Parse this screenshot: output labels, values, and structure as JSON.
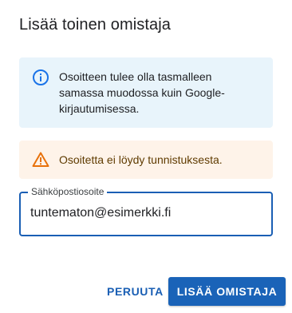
{
  "dialog": {
    "title": "Lisää toinen omistaja"
  },
  "info_notice": {
    "icon": "info-icon",
    "text": "Osoitteen tulee olla tasmalleen samassa muodossa kuin Google-kirjautumisessa.",
    "background": "#e8f4fb",
    "icon_color": "#1a73e8"
  },
  "warning_notice": {
    "icon": "warning-icon",
    "text": "Osoitetta ei löydy tunnistuksesta.",
    "background": "#fef3e9",
    "icon_color": "#e8710a"
  },
  "email_field": {
    "label": "Sähköpostiosoite",
    "value": "tuntematon@esimerkki.fi"
  },
  "actions": {
    "cancel_label": "PERUUTA",
    "confirm_label": "LISÄÄ OMISTAJA"
  },
  "colors": {
    "accent": "#1a5fb4"
  }
}
